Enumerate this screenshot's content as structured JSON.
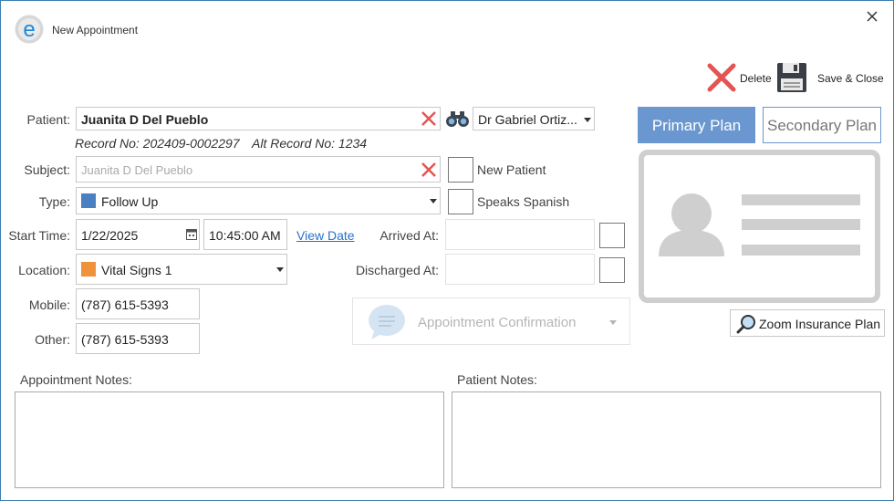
{
  "window": {
    "title": "New Appointment"
  },
  "toolbar": {
    "delete_label": "Delete",
    "save_close_label": "Save & Close"
  },
  "form": {
    "patient_label": "Patient:",
    "patient_value": "Juanita D Del Pueblo",
    "record_no": "Record No: 202409-0002297",
    "alt_record_no": "Alt Record No: 1234",
    "doctor_value": "Dr Gabriel Ortiz...",
    "subject_label": "Subject:",
    "subject_placeholder": "Juanita D Del Pueblo",
    "new_patient_label": "New Patient",
    "type_label": "Type:",
    "type_value": "Follow Up",
    "type_color": "#4a7fc1",
    "speaks_spanish_label": "Speaks Spanish",
    "start_time_label": "Start Time:",
    "start_date_value": "1/22/2025",
    "start_time_value": "10:45:00 AM",
    "view_date_label": "View Date",
    "arrived_at_label": "Arrived At:",
    "location_label": "Location:",
    "location_value": "Vital Signs 1",
    "location_color": "#f0923c",
    "discharged_at_label": "Discharged At:",
    "mobile_label": "Mobile:",
    "mobile_value": "(787) 615-5393",
    "other_label": "Other:",
    "other_value": "(787) 615-5393",
    "appointment_confirmation_label": "Appointment Confirmation",
    "appointment_notes_label": "Appointment Notes:",
    "patient_notes_label": "Patient Notes:"
  },
  "insurance": {
    "primary_plan_label": "Primary Plan",
    "secondary_plan_label": "Secondary Plan",
    "zoom_label": "Zoom Insurance Plan",
    "primary_color": "#6a97cf"
  }
}
